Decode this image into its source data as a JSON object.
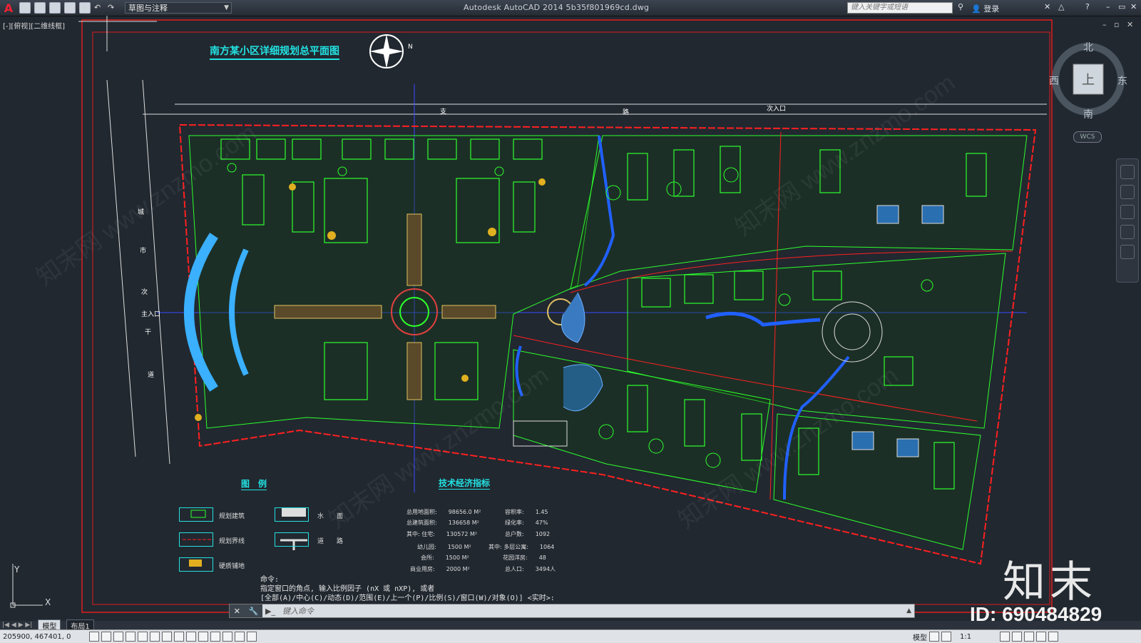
{
  "app": {
    "window_title": "Autodesk AutoCAD 2014    5b35f801969cd.dwg",
    "workspace": "草图与注释",
    "search_placeholder": "键入关键字或短语",
    "login": "登录"
  },
  "viewport": {
    "view_label": "[-][俯视][二维线框]"
  },
  "viewcube": {
    "north": "北",
    "south": "南",
    "east": "东",
    "west": "西",
    "face": "上",
    "wcs": "WCS"
  },
  "drawing": {
    "title": "南方某小区详细规划总平面图",
    "north_arrow": "N",
    "road_top_1": "支",
    "road_top_2": "路",
    "entrance_north": "次入口",
    "road_left": [
      "城",
      "市",
      "次",
      "干",
      "道"
    ],
    "entrance_main": "主入口",
    "legend_title": "图　例",
    "legend": [
      {
        "label": "规划建筑",
        "icon": "building-icon"
      },
      {
        "label": "规划界线",
        "icon": "boundary-line-icon"
      },
      {
        "label": "硬质铺地",
        "icon": "paving-icon"
      },
      {
        "label": "水　　面",
        "icon": "water-icon"
      },
      {
        "label": "道　　路",
        "icon": "road-icon"
      }
    ],
    "econ_title": "技术经济指标",
    "econ_left": [
      "总用地面积:　　98656.0 M²",
      "总建筑面积:　　136658 M²",
      "其中: 住宅:　　130572 M²",
      "幼儿园:　　1500 M²",
      "会所:　　1500 M²",
      "商业用房:　　2000 M²"
    ],
    "econ_right": [
      "容积率:　　1.45",
      "绿化率:　　47%",
      "总户数:　　1092",
      "其中: 多层公寓:　　1064",
      "花园洋房:　　48",
      "总人口:　　3494人"
    ]
  },
  "command": {
    "history": [
      "命令:",
      "指定窗口的角点, 输入比例因子 (nX 或 nXP), 或者",
      "[全部(A)/中心(C)/动态(D)/范围(E)/上一个(P)/比例(S)/窗口(W)/对象(O)] <实时>:"
    ],
    "placeholder": "键入命令"
  },
  "layout_tabs": [
    "模型",
    "布局1"
  ],
  "status": {
    "coords": "205900,   467401,  0",
    "model": "模型",
    "scale": "1:1"
  },
  "brand": {
    "name": "知末",
    "id": "ID: 690484829",
    "watermark": "知末网 www.znzmo.com"
  }
}
